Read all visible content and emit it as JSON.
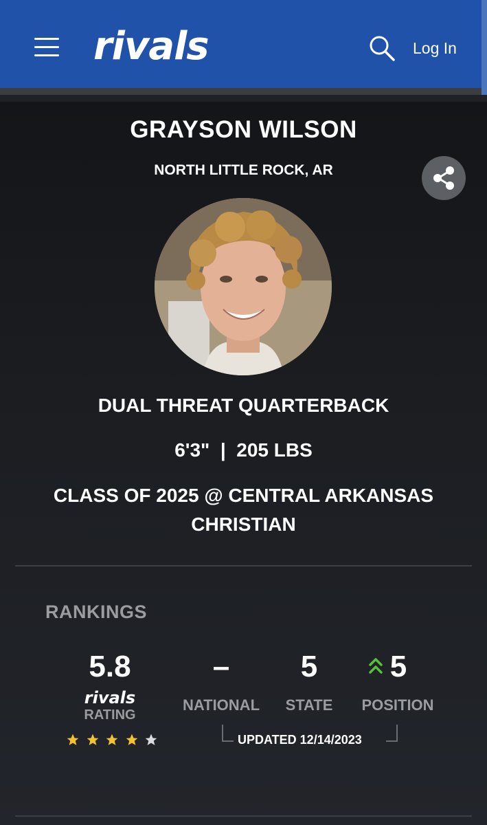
{
  "header": {
    "logo_text": "rivals",
    "login_label": "Log In",
    "icons": [
      "menu-icon",
      "search-icon"
    ],
    "brand_color": "#1f52a8"
  },
  "player": {
    "name": "GRAYSON WILSON",
    "hometown": "NORTH LITTLE ROCK, AR",
    "position": "DUAL THREAT QUARTERBACK",
    "measurements": "6'3\"  |  205 LBS",
    "class_line": "CLASS OF 2025 @ CENTRAL ARKANSAS CHRISTIAN"
  },
  "rankings": {
    "title": "RANKINGS",
    "rating_value": "5.8",
    "rating_brand": "rivals",
    "rating_label": "RATING",
    "stars_filled": 4,
    "stars_total": 5,
    "star_color": "#f2c230",
    "national_value": "–",
    "national_label": "NATIONAL",
    "state_value": "5",
    "state_label": "STATE",
    "position_value": "5",
    "position_label": "POSITION",
    "position_trend": "up",
    "trend_color": "#56c23c",
    "updated": "UPDATED 12/14/2023"
  }
}
